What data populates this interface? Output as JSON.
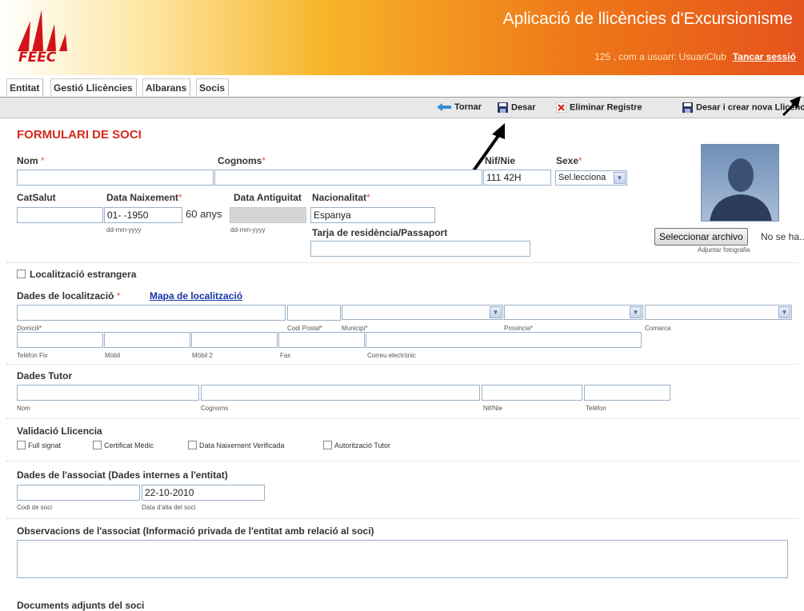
{
  "header": {
    "logo_text": "FEEC",
    "app_title": "Aplicació de llicències d'Excursionisme",
    "user_line": "125 , com a usuari: UsuariClub",
    "logout": "Tancar sessió"
  },
  "menu": [
    "Entitat",
    "Gestió Llicències",
    "Albarans",
    "Socis"
  ],
  "toolbar": {
    "back": "Tornar",
    "save": "Desar",
    "delete": "Eliminar Registre",
    "save_new": "Desar i crear nova Llicència"
  },
  "form": {
    "title": "FORMULARI DE SOCI",
    "nom": "Nom",
    "cognoms": "Cognoms",
    "nif": "Nif/Nie",
    "nif_value": "111    42H",
    "sexe": "Sexe",
    "sexe_value": "Sel.lecciona",
    "catsalut": "CatSalut",
    "data_naixement": "Data Naixement",
    "data_naixement_value": "01-  -1950",
    "age": "60 anys",
    "date_format": "dd-mm-yyyy",
    "data_antiguitat": "Data Antiguitat",
    "nacionalitat": "Nacionalitat",
    "nacionalitat_value": "Espanya",
    "tarja": "Tarja de residència/Passaport",
    "photo_button": "Seleccionar archivo",
    "photo_status": "No se ha...",
    "photo_caption": "Adjuntar fotografia",
    "localitzacio_estrangera": "Localització estrangera",
    "dades_localitzacio": "Dades de localització",
    "mapa": "Mapa de localització",
    "addr_labels": {
      "domicili": "Domicili*",
      "codi_postal": "Codi Postal*",
      "municipi": "Municipi*",
      "provincia": "Provincia*",
      "comarca": "Comarca"
    },
    "contact_labels": {
      "telefon": "Telèfon Fix",
      "mobil": "Mòbil",
      "mobil2": "Mòbil 2",
      "fax": "Fax",
      "correu": "Correu electrònic"
    },
    "dades_tutor": "Dades Tutor",
    "tutor_labels": {
      "nom": "Nom",
      "cognoms": "Cognoms",
      "nif": "Nif/Nie",
      "telefon": "Telèfon"
    },
    "validacio": "Validació Llicencia",
    "checks": [
      "Full signat",
      "Certificat Mèdic",
      "Data Naixement Verificada",
      "Autorització Tutor"
    ],
    "dades_associat": "Dades de l'associat (Dades internes a l'entitat)",
    "alta_value": "22-10-2010",
    "codi_soci": "Codi de soci",
    "data_alta": "Data d'alta del soci",
    "observacions": "Observacions de l'associat (Informació privada de l'entitat amb relació al soci)",
    "documents": "Documents adjunts del soci"
  },
  "colors": {
    "title_red": "#d42a1c",
    "link_blue": "#1533a4",
    "header_orange": "#ef7a17"
  }
}
